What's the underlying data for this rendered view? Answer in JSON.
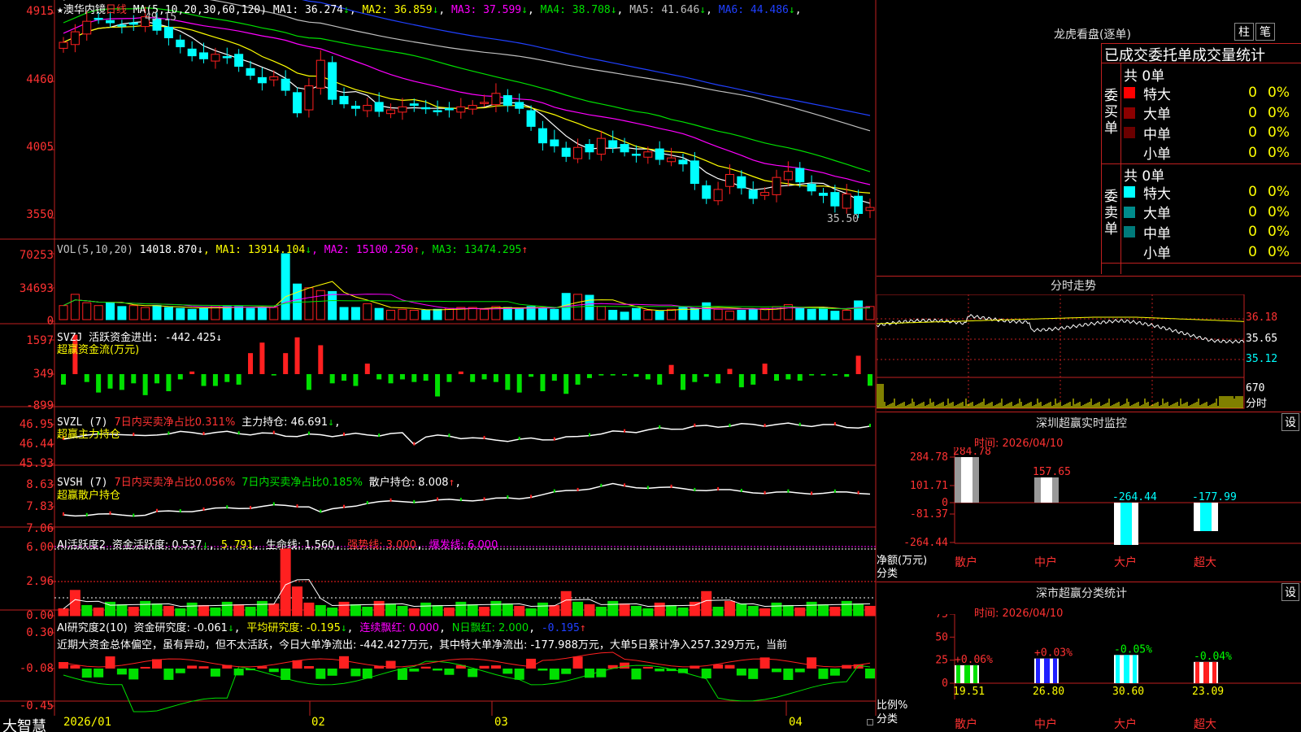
{
  "stock": {
    "name": "澳华内镜",
    "period": "日线",
    "star": "★"
  },
  "main": {
    "ma_header": "MA(5,10,20,30,60,120)",
    "ma": [
      {
        "label": "MA1: 36.274",
        "arrow": "↓",
        "color": "#ffffff"
      },
      {
        "label": "MA2: 36.859",
        "arrow": "↓",
        "color": "#ffff00"
      },
      {
        "label": "MA3: 37.599",
        "arrow": "↓",
        "color": "#ff00ff"
      },
      {
        "label": "MA4: 38.708",
        "arrow": "↓",
        "color": "#00e000"
      },
      {
        "label": "MA5: 41.646",
        "arrow": "↓",
        "color": "#c0c0c0"
      },
      {
        "label": "MA6: 44.486",
        "arrow": "↓",
        "color": "#2040ff"
      }
    ],
    "yticks": [
      "4915",
      "4460",
      "4005",
      "3550"
    ],
    "hi_label": "49.15",
    "lo_label": "35.50"
  },
  "vol": {
    "header": "VOL(5,10,20)",
    "value": "14018.870",
    "arrow": "↓",
    "ma": [
      {
        "label": "MA1: 13914.104",
        "arrow": "↓",
        "color": "#ffff00"
      },
      {
        "label": "MA2: 15100.250",
        "arrow": "↑",
        "color": "#ff00ff"
      },
      {
        "label": "MA3: 13474.295",
        "arrow": "↑",
        "color": "#00e000"
      }
    ],
    "yticks": [
      "70253",
      "34693",
      "0"
    ]
  },
  "svzj": {
    "header": "SVZJ  活跃资金进出: -442.425",
    "arrow": "↓",
    "sub": "超赢资金流(万元)",
    "yticks": [
      "1597",
      "349",
      "-899"
    ]
  },
  "svzl": {
    "header": "SVZL (7)",
    "h2": "7日内买卖净占比0.311%",
    "h3": "主力持仓: 46.691",
    "arrow": "↓",
    "sub": "超赢主力持仓",
    "yticks": [
      "46.95",
      "46.44",
      "45.93"
    ]
  },
  "svsh": {
    "header": "SVSH (7)",
    "h2": "7日内买卖净占比0.056%",
    "h3": "7日内买卖净占比0.185%",
    "h4": "散户持仓: 8.008",
    "arrow": "↑",
    "sub": "超赢散户持仓",
    "yticks": [
      "8.63",
      "7.83",
      "7.06"
    ]
  },
  "ai1": {
    "header": "AI活跃度2",
    "h2": "资金活跃度: 0.537",
    "a2": "↓",
    "h3": "5.791",
    "h4": "生命线: 1.560",
    "h5": "强势线: 3.000",
    "h6": "爆发线: 6.000",
    "yticks": [
      "6.00",
      "2.96",
      "0.00"
    ]
  },
  "ai2": {
    "header": "AI研究度2(10)",
    "h2": "资金研究度: -0.061",
    "a2": "↓",
    "h3": "平均研究度: -0.195",
    "a3": "↓",
    "h4": "连续飘红: 0.000",
    "h5": "N日飘红: 2.000",
    "h6": "-0.195",
    "a6": "↑",
    "desc": "近期大资金总体偏空，虽有异动，但不太活跃，今日大单净流出: -442.427万元，其中特大单净流出: -177.988万元，大单5日累计净入257.329万元，当前",
    "yticks": [
      "0.30",
      "-0.08",
      "-0.45"
    ]
  },
  "xaxis": [
    "2026/01",
    "02",
    "03",
    "04"
  ],
  "brand": "大智慧",
  "right": {
    "lhb_title": "龙虎看盘(逐单)",
    "btn_zhu": "柱",
    "btn_bi": "笔",
    "tab_title": "已成交委托单成交量统计",
    "buy": {
      "label": "委买单",
      "total": "共 0单",
      "rows": [
        {
          "name": "特大",
          "v": "0",
          "p": "0%",
          "color": "#ff0000"
        },
        {
          "name": "大单",
          "v": "0",
          "p": "0%",
          "color": "#8b0000"
        },
        {
          "name": "中单",
          "v": "0",
          "p": "0%",
          "color": "#6b0000"
        },
        {
          "name": "小单",
          "v": "0",
          "p": "0%",
          "color": "#000000"
        }
      ]
    },
    "sell": {
      "label": "委卖单",
      "total": "共 0单",
      "rows": [
        {
          "name": "特大",
          "v": "0",
          "p": "0%",
          "color": "#00ffff"
        },
        {
          "name": "大单",
          "v": "0",
          "p": "0%",
          "color": "#008b8b"
        },
        {
          "name": "中单",
          "v": "0",
          "p": "0%",
          "color": "#007a7a"
        },
        {
          "name": "小单",
          "v": "0",
          "p": "0%",
          "color": "#000000"
        }
      ]
    },
    "fs_title": "分时走势",
    "fs_yticks": [
      "36.18",
      "35.65",
      "35.12"
    ],
    "fs_vol": "670",
    "fs_unit": "分时",
    "sz_title": "深圳超赢实时监控",
    "sz_btn": "设",
    "sz_time": "时间: 2026/04/10",
    "sz_yticks": [
      "284.78",
      "101.71",
      "0",
      "-81.37",
      "-264.44"
    ],
    "sz_ylabel": "净额(万元)",
    "sz_xlabel": "分类",
    "sz_cats": [
      "散户",
      "中户",
      "大户",
      "超大"
    ],
    "sz_vals": [
      "284.78",
      "157.65",
      "-264.44",
      "-177.99"
    ],
    "fl_title": "深市超赢分类统计",
    "fl_btn": "设",
    "fl_time": "时间: 2026/04/10",
    "fl_yticks": [
      "75",
      "50",
      "25",
      "0"
    ],
    "fl_ylabel": "比例%",
    "fl_xlabel": "分类",
    "fl_cats": [
      "散户",
      "中户",
      "大户",
      "超大"
    ],
    "fl_pct": [
      "+0.06%",
      "+0.03%",
      "-0.05%",
      "-0.04%"
    ],
    "fl_vals": [
      "19.51",
      "26.80",
      "30.60",
      "23.09"
    ]
  },
  "chart_data": [
    {
      "type": "candlestick",
      "title": "澳华内镜 日线",
      "ylim": [
        35.5,
        49.15
      ],
      "yticks": [
        49.15,
        44.6,
        40.05,
        35.5
      ],
      "ohlc_close": [
        47.2,
        47.9,
        48.6,
        48.8,
        48.5,
        48.3,
        48.4,
        48.9,
        48.0,
        47.5,
        46.9,
        46.3,
        46.1,
        46.4,
        46.2,
        45.6,
        45.0,
        44.5,
        44.9,
        44.0,
        42.5,
        44.3,
        46.0,
        43.4,
        43.1,
        42.8,
        43.0,
        42.6,
        42.7,
        42.9,
        43.0,
        42.8,
        42.6,
        42.7,
        42.9,
        43.0,
        43.2,
        43.8,
        43.0,
        42.8,
        41.6,
        40.5,
        40.3,
        39.6,
        40.2,
        39.9,
        40.8,
        40.2,
        39.9,
        39.7,
        39.9,
        39.4,
        39.5,
        39.1,
        37.8,
        36.8,
        37.4,
        38.4,
        37.5,
        36.8,
        37.2,
        38.2,
        38.6,
        37.9,
        37.3,
        37.0,
        36.3,
        37.1,
        35.8,
        36.2
      ]
    },
    {
      "type": "bar",
      "title": "VOL(5,10,20)",
      "values": [
        15000,
        27000,
        18000,
        15000,
        18000,
        14000,
        15000,
        13000,
        15000,
        13000,
        12000,
        11000,
        12000,
        15000,
        14000,
        14000,
        12000,
        13000,
        13000,
        70253,
        38000,
        34000,
        31000,
        30000,
        13000,
        13000,
        17000,
        12000,
        10000,
        11000,
        10000,
        10000,
        11000,
        12000,
        13000,
        13000,
        11000,
        14000,
        13000,
        12000,
        14000,
        12000,
        11000,
        28000,
        27000,
        26000,
        14000,
        10000,
        8000,
        12000,
        10000,
        9000,
        11000,
        13000,
        12000,
        18000,
        11000,
        9000,
        10000,
        11000,
        12000,
        14000,
        16000,
        13000,
        11000,
        13000,
        9000,
        10000,
        20000,
        14018
      ]
    },
    {
      "type": "bar",
      "title": "SVZJ 活跃资金进出",
      "values": [
        -400,
        1500,
        -300,
        -700,
        -550,
        -600,
        -350,
        -800,
        -350,
        -650,
        -200,
        100,
        -450,
        -450,
        -300,
        -400,
        800,
        1200,
        -50,
        800,
        1400,
        -600,
        1100,
        -350,
        -250,
        -450,
        400,
        -200,
        -350,
        -200,
        -300,
        -250,
        -850,
        -300,
        100,
        -300,
        -200,
        -300,
        -600,
        -700,
        -100,
        -650,
        -250,
        -750,
        -400,
        -150,
        -50,
        -50,
        -50,
        -100,
        -200,
        -400,
        350,
        -600,
        -300,
        -100,
        -350,
        200,
        -500,
        -400,
        400,
        -250,
        -200,
        -250,
        -50,
        -50,
        -50,
        -100,
        700,
        -442
      ]
    },
    {
      "type": "line",
      "title": "SVZL 主力持仓",
      "ylim": [
        45.93,
        46.95
      ]
    },
    {
      "type": "line",
      "title": "SVSH 散户持仓",
      "ylim": [
        7.06,
        8.63
      ]
    },
    {
      "type": "bar",
      "title": "AI活跃度2",
      "ylim": [
        0,
        6
      ]
    },
    {
      "type": "bar",
      "title": "AI研究度2(10)",
      "ylim": [
        -0.45,
        0.3
      ]
    },
    {
      "type": "bar",
      "title": "深圳超赢实时监控",
      "categories": [
        "散户",
        "中户",
        "大户",
        "超大"
      ],
      "values": [
        284.78,
        157.65,
        -264.44,
        -177.99
      ]
    },
    {
      "type": "bar",
      "title": "深市超赢分类统计",
      "categories": [
        "散户",
        "中户",
        "大户",
        "超大"
      ],
      "values": [
        19.51,
        26.8,
        30.6,
        23.09
      ]
    }
  ]
}
